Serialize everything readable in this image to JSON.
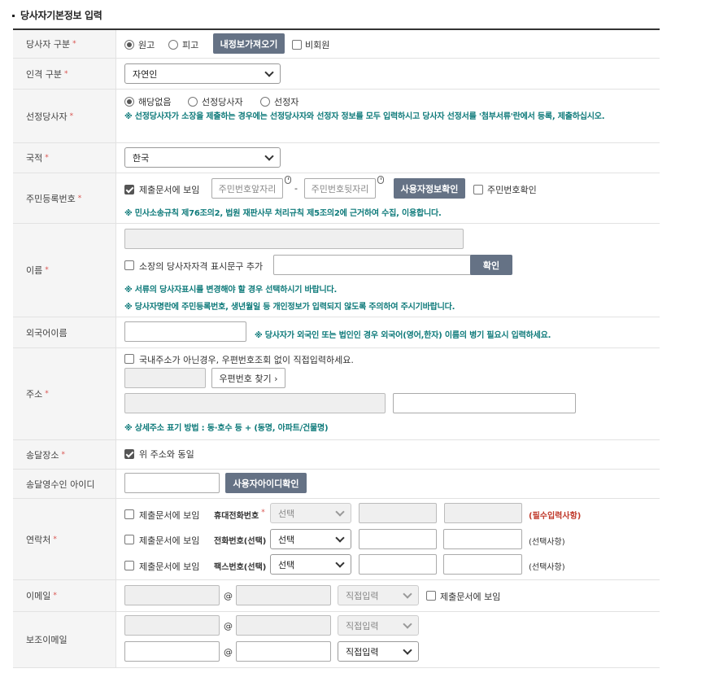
{
  "title": "당사자기본정보 입력",
  "required_mark": "*",
  "rows": {
    "party_type": {
      "label": "당사자 구분",
      "options": [
        "원고",
        "피고"
      ],
      "selected": "원고",
      "fetch_button": "내정보가져오기",
      "nonmember": "비회원"
    },
    "person_type": {
      "label": "인격 구분",
      "value": "자연인"
    },
    "selected_party": {
      "label": "선정당사자",
      "options": [
        "해당없음",
        "선정당사자",
        "선정자"
      ],
      "selected": "해당없음",
      "note": "※ 선정당사자가 소장을 제출하는 경우에는 선정당사자와 선정자 정보를 모두 입력하시고 당사자 선정서를 '첨부서류'란에서 등록, 제출하십시오."
    },
    "nationality": {
      "label": "국적",
      "value": "한국"
    },
    "resident_no": {
      "label": "주민등록번호",
      "show_in_doc": "제출문서에 보임",
      "front_placeholder": "주민번호앞자리",
      "separator": "-",
      "back_placeholder": "주민번호뒷자리",
      "verify_button": "사용자정보확인",
      "confirm_check": "주민번호확인",
      "note": "※ 민사소송규칙 제76조의2, 법원 재판사무 처리규칙 제5조의2에 근거하여 수집, 이용합니다."
    },
    "name": {
      "label": "이름",
      "add_check": "소장의 당사자자격 표시문구 추가",
      "confirm_button": "확인",
      "note1": "※ 서류의 당사자표시를 변경해야 할 경우 선택하시기 바랍니다.",
      "note2": "※ 당사자명란에 주민등록번호, 생년월일 등 개인정보가 입력되지 않도록 주의하여 주시기바랍니다."
    },
    "foreign_name": {
      "label": "외국어이름",
      "note": "※ 당사자가 외국인 또는 법인인 경우 외국어(영어,한자) 이름의 병기 필요시 입력하세요."
    },
    "address": {
      "label": "주소",
      "direct_check": "국내주소가 아닌경우, 우편번호조회 없이 직접입력하세요.",
      "postal_button": "우편번호 찾기 ›",
      "note": "※ 상세주소 표기 방법 : 동·호수 등 + (동명, 아파트/건물명)"
    },
    "delivery": {
      "label": "송달장소",
      "same_check": "위 주소와 동일"
    },
    "recipient_id": {
      "label": "송달영수인 아이디",
      "verify_button": "사용자아이디확인"
    },
    "contact": {
      "label": "연락처",
      "lines": [
        {
          "show": "제출문서에 보임",
          "type": "휴대전화번호",
          "required": true,
          "select": "선택",
          "disabled": true,
          "hint": "(필수입력사항)",
          "hint_red": true
        },
        {
          "show": "제출문서에 보임",
          "type": "전화번호(선택)",
          "required": false,
          "select": "선택",
          "disabled": false,
          "hint": "(선택사항)",
          "hint_red": false
        },
        {
          "show": "제출문서에 보임",
          "type": "팩스번호(선택)",
          "required": false,
          "select": "선택",
          "disabled": false,
          "hint": "(선택사항)",
          "hint_red": false
        }
      ]
    },
    "email": {
      "label": "이메일",
      "at": "@",
      "domain_select": "직접입력",
      "show_in_doc": "제출문서에 보임"
    },
    "sub_email": {
      "label": "보조이메일",
      "at": "@",
      "domain_select_1": "직접입력",
      "domain_select_2": "직접입력"
    }
  }
}
